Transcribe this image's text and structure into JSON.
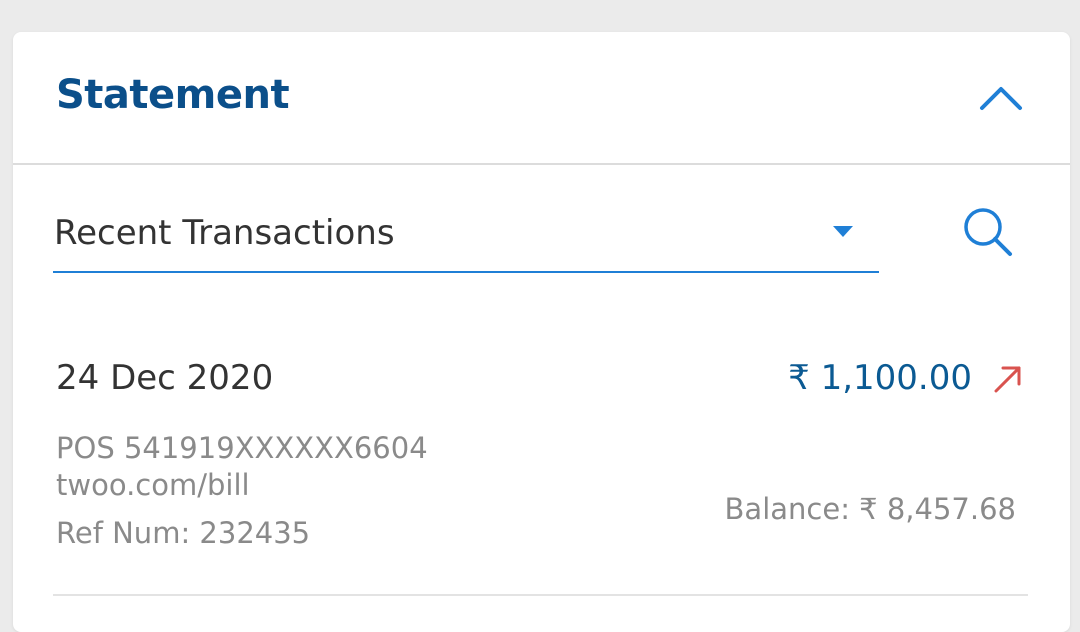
{
  "header": {
    "title": "Statement",
    "collapse_icon": "chevron-up-icon"
  },
  "filter": {
    "selected": "Recent Transactions",
    "dropdown_icon": "caret-down-icon",
    "search_icon": "search-icon"
  },
  "transactions": [
    {
      "date": "24 Dec 2020",
      "amount": "₹ 1,100.00",
      "direction_icon": "arrow-up-right-icon",
      "description_line1": "POS 541919XXXXXX6604",
      "description_line2": "twoo.com/bill",
      "ref": "Ref Num: 232435",
      "balance": "Balance:  ₹ 8,457.68"
    }
  ],
  "colors": {
    "accent": "#1f7fd6",
    "title": "#0b4f8a",
    "amount": "#0b5a93",
    "debit_arrow": "#d9534f",
    "muted_text": "#8a8a8a",
    "background": "#ebebeb"
  }
}
